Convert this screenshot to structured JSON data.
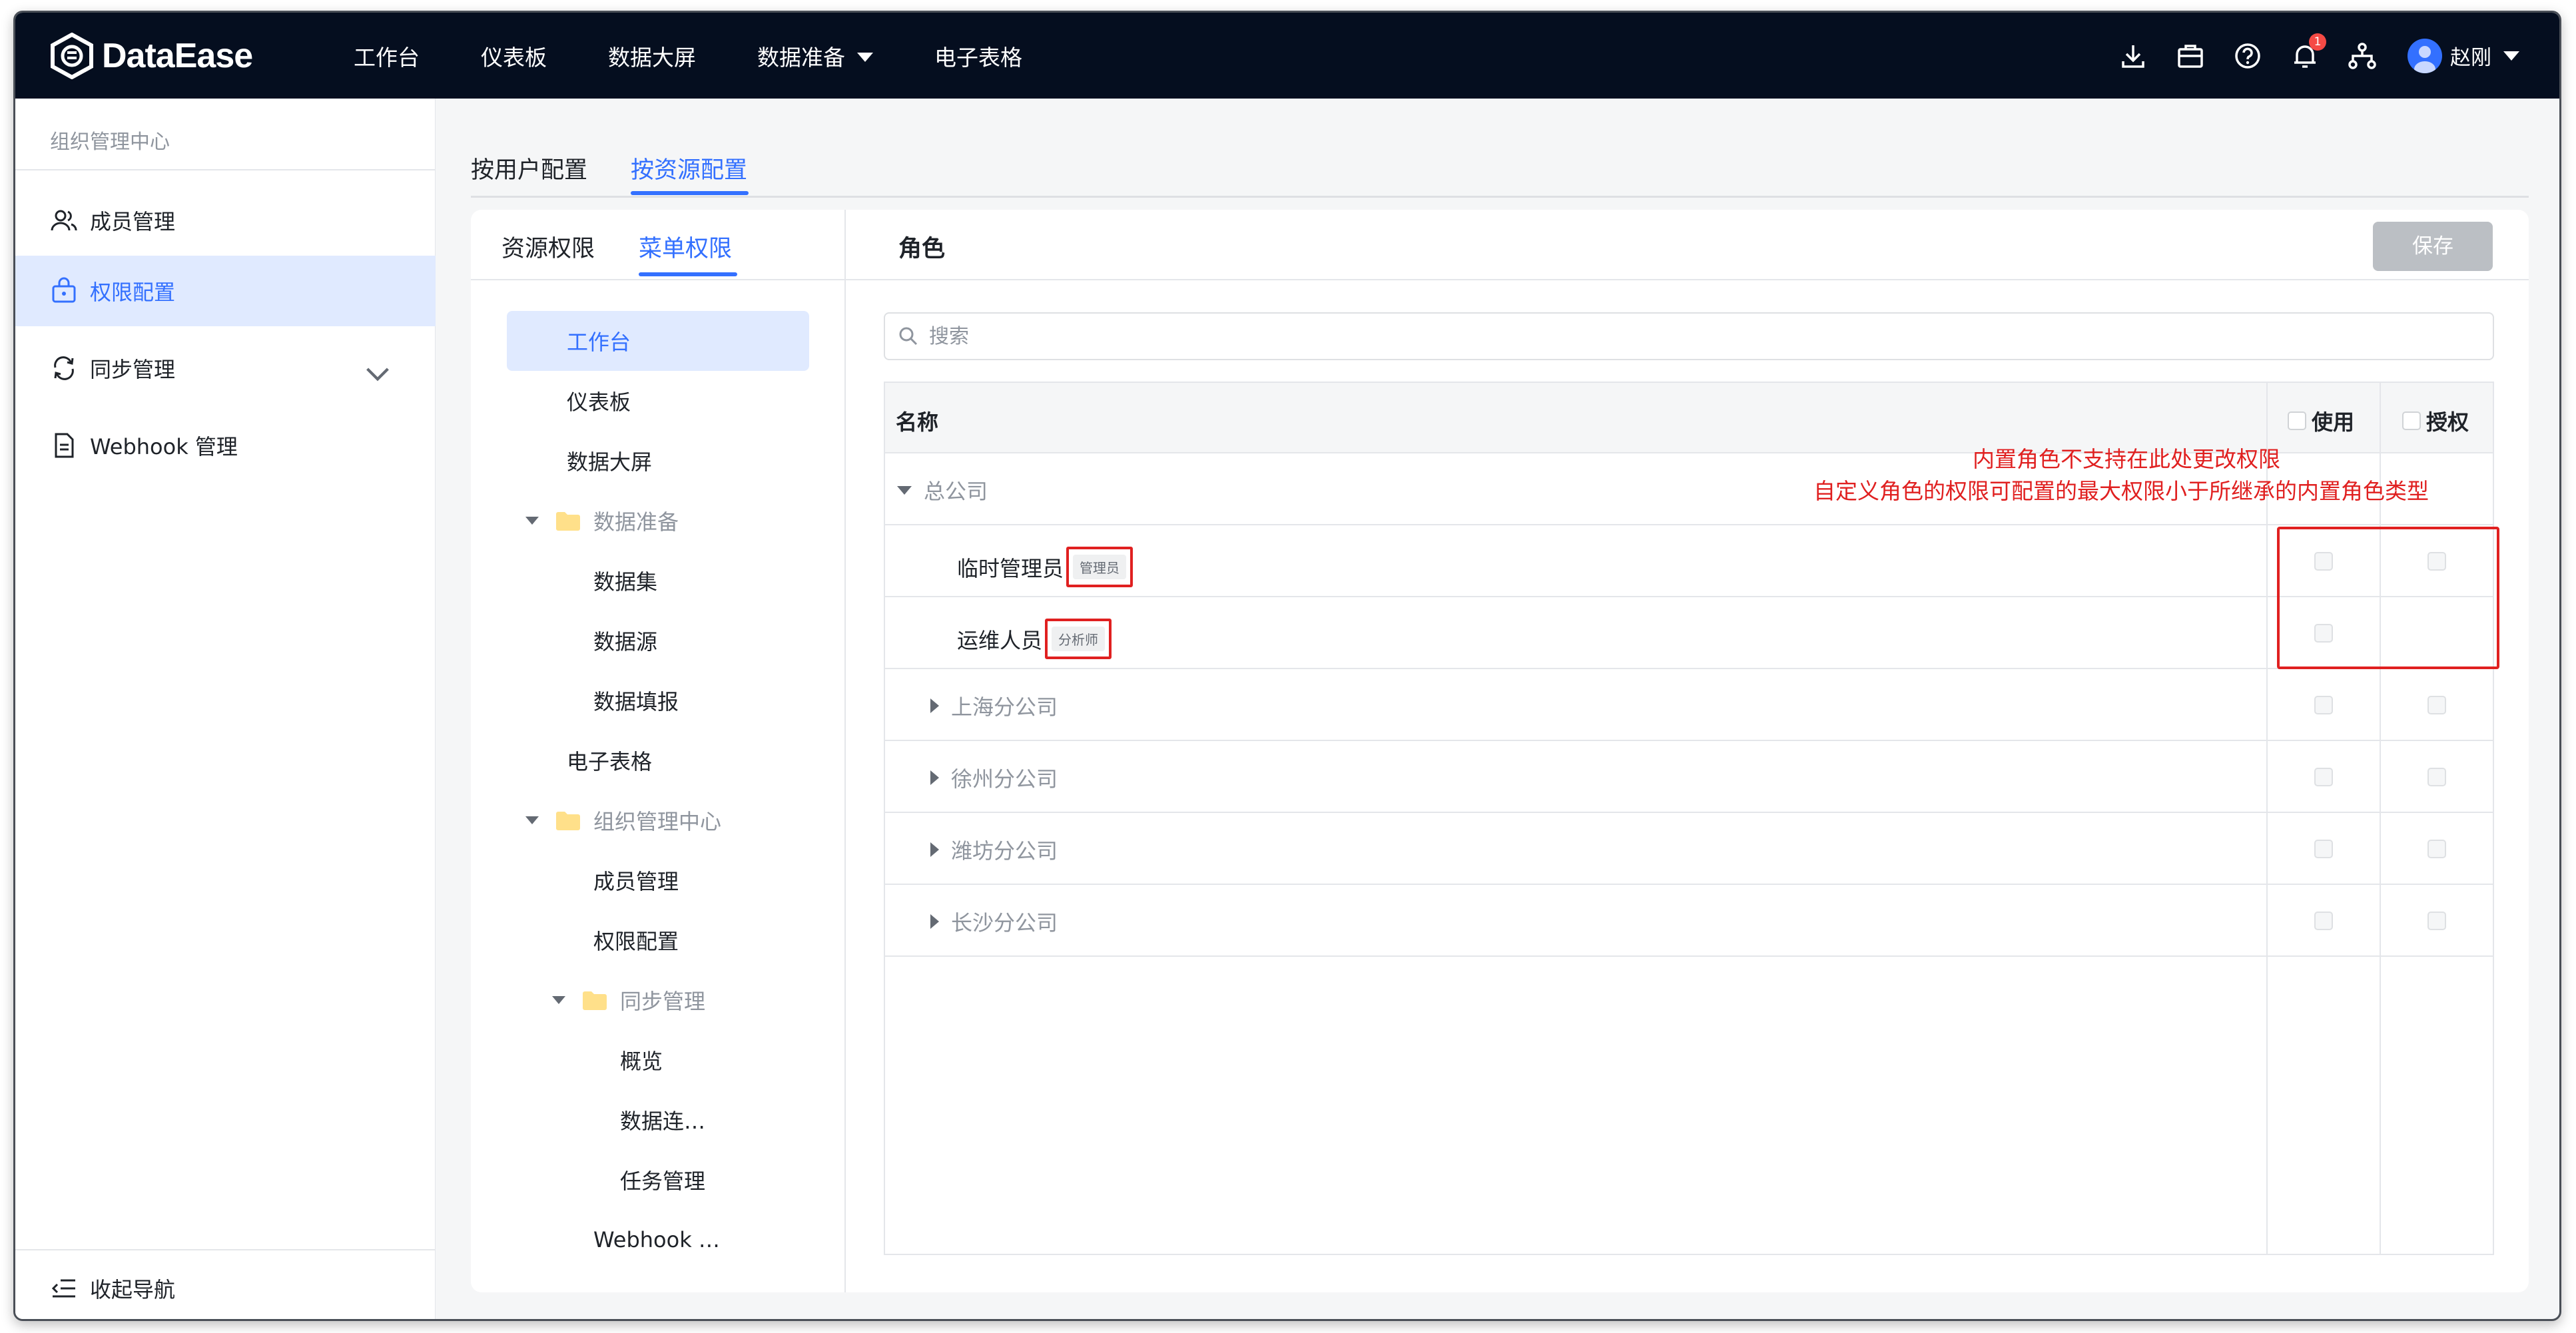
{
  "app": {
    "name": "DataEase"
  },
  "nav": {
    "items": [
      "工作台",
      "仪表板",
      "数据大屏",
      "数据准备",
      "电子表格"
    ]
  },
  "header": {
    "notification_count": "1",
    "user_name": "赵刚"
  },
  "sidebar": {
    "header": "组织管理中心",
    "items": [
      {
        "label": "成员管理"
      },
      {
        "label": "权限配置"
      },
      {
        "label": "同步管理"
      },
      {
        "label": "Webhook 管理"
      }
    ],
    "collapse_label": "收起导航"
  },
  "tabs": {
    "by_user": "按用户配置",
    "by_resource": "按资源配置"
  },
  "subtabs": {
    "resource": "资源权限",
    "menu": "菜单权限"
  },
  "roles_title": "角色",
  "save_label": "保存",
  "menu_tree": [
    {
      "label": "工作台"
    },
    {
      "label": "仪表板"
    },
    {
      "label": "数据大屏"
    },
    {
      "label": "数据准备"
    },
    {
      "label": "数据集"
    },
    {
      "label": "数据源"
    },
    {
      "label": "数据填报"
    },
    {
      "label": "电子表格"
    },
    {
      "label": "组织管理中心"
    },
    {
      "label": "成员管理"
    },
    {
      "label": "权限配置"
    },
    {
      "label": "同步管理"
    },
    {
      "label": "概览"
    },
    {
      "label": "数据连…"
    },
    {
      "label": "任务管理"
    },
    {
      "label": "Webhook …"
    }
  ],
  "search": {
    "placeholder": "搜索"
  },
  "table": {
    "col_name": "名称",
    "col_use": "使用",
    "col_auth": "授权",
    "rows": [
      {
        "label": "总公司"
      },
      {
        "label": "临时管理员",
        "tag": "管理员"
      },
      {
        "label": "运维人员",
        "tag": "分析师"
      },
      {
        "label": "上海分公司"
      },
      {
        "label": "徐州分公司"
      },
      {
        "label": "潍坊分公司"
      },
      {
        "label": "长沙分公司"
      }
    ]
  },
  "annotation": {
    "line1": "内置角色不支持在此处更改权限",
    "line2": "自定义角色的权限可配置的最大权限小于所继承的内置角色类型"
  },
  "colors": {
    "accent": "#3370ff",
    "topbar": "#050e1f",
    "annotation": "#e02020"
  }
}
